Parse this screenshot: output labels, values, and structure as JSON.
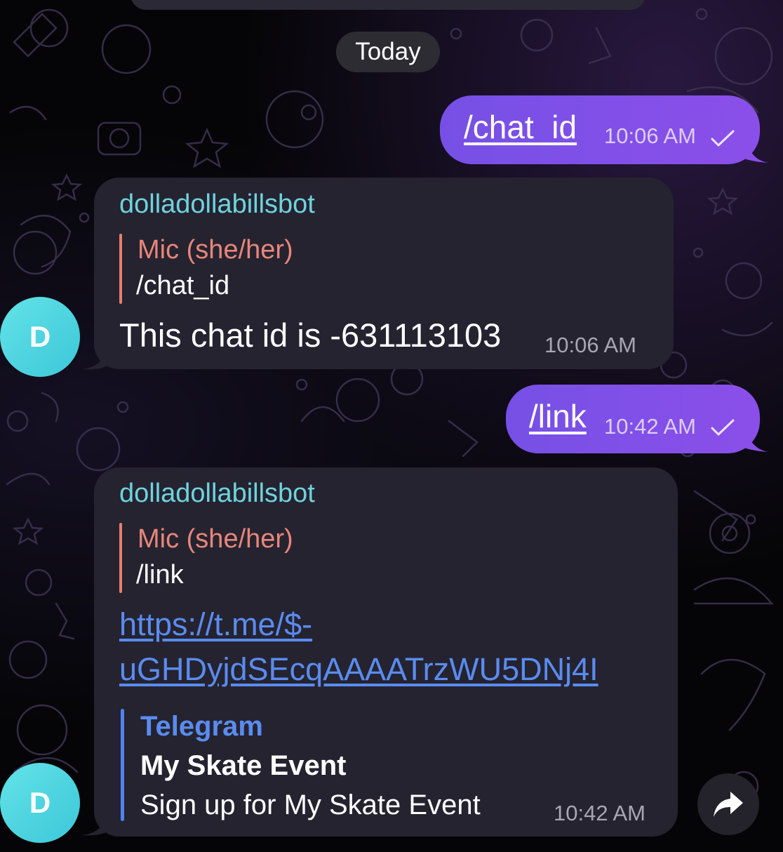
{
  "date_separator": "Today",
  "messages": [
    {
      "direction": "outgoing",
      "text": "/chat_id",
      "time": "10:06 AM",
      "status": "sent-check"
    },
    {
      "direction": "incoming",
      "sender": "dolladollabillsbot",
      "reply": {
        "name": "Mic (she/her)",
        "text": "/chat_id"
      },
      "text": "This chat id is -631113103",
      "time": "10:06 AM",
      "avatar_letter": "D"
    },
    {
      "direction": "outgoing",
      "text": "/link",
      "time": "10:42 AM",
      "status": "sent-check"
    },
    {
      "direction": "incoming",
      "sender": "dolladollabillsbot",
      "reply": {
        "name": "Mic (she/her)",
        "text": "/link"
      },
      "link_line1": "https://t.me/$-",
      "link_line2": "uGHDyjdSEcqAAAATrzWU5DNj4I",
      "preview": {
        "site": "Telegram",
        "title": "My Skate Event",
        "description": "Sign up for My Skate Event"
      },
      "time": "10:42 AM",
      "avatar_letter": "D"
    }
  ],
  "icons": {
    "share": "share-arrow-icon",
    "check": "check-icon"
  },
  "colors": {
    "outgoing_bubble": "#8050e8",
    "incoming_bubble": "#252330",
    "sender_name": "#6fd3dd",
    "reply_accent": "#e8867a",
    "link": "#5a8cf0",
    "avatar": "#4fd5e0"
  }
}
